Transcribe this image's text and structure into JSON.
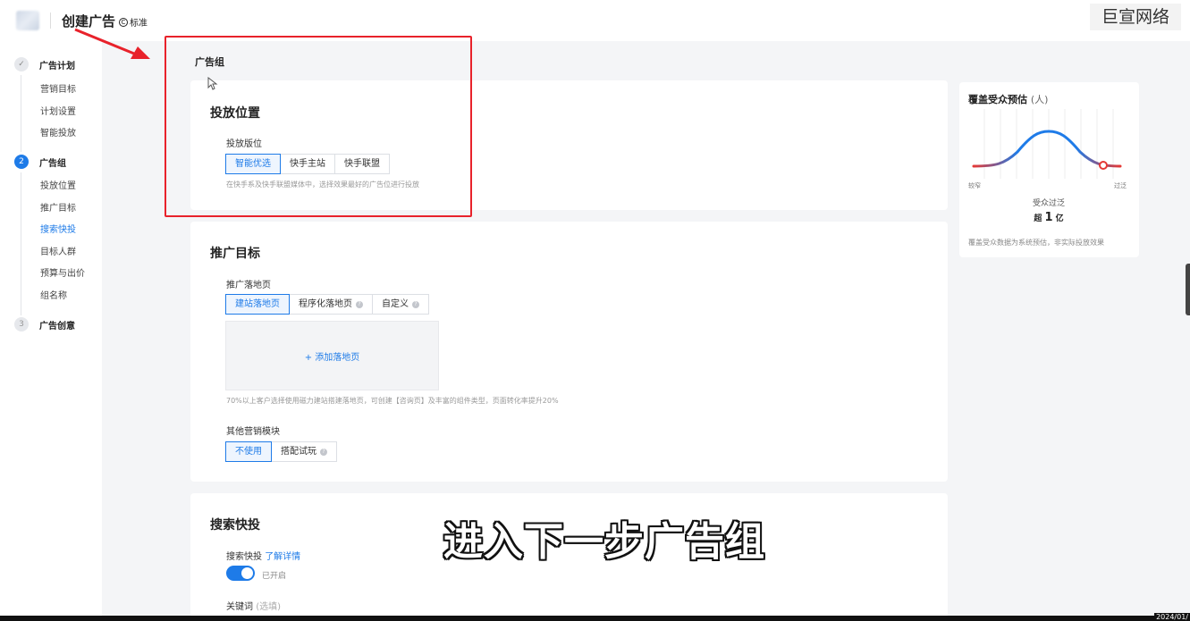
{
  "header": {
    "title": "创建广告",
    "badge": "标准",
    "watermark": "巨宣网络"
  },
  "sidebar": {
    "steps": [
      {
        "number": "✓",
        "title": "广告计划",
        "items": [
          "营销目标",
          "计划设置",
          "智能投放"
        ]
      },
      {
        "number": "2",
        "title": "广告组",
        "items": [
          "投放位置",
          "推广目标",
          "搜索快投",
          "目标人群",
          "预算与出价",
          "组名称"
        ],
        "current_item": "搜索快投"
      },
      {
        "number": "3",
        "title": "广告创意",
        "items": []
      }
    ]
  },
  "main": {
    "group_title": "广告组",
    "placement": {
      "title": "投放位置",
      "field_label": "投放版位",
      "options": [
        "智能优选",
        "快手主站",
        "快手联盟"
      ],
      "selected": "智能优选",
      "hint": "在快手系及快手联盟媒体中，选择效果最好的广告位进行投放"
    },
    "target": {
      "title": "推广目标",
      "landing_label": "推广落地页",
      "landing_options": [
        "建站落地页",
        "程序化落地页",
        "自定义"
      ],
      "selected": "建站落地页",
      "add_button": "+ 添加落地页",
      "hint": "70%以上客户选择使用磁力建站搭建落地页，可创建【咨询页】及丰富的组件类型，页面转化率提升20%",
      "other_label": "其他营销模块",
      "other_options": [
        "不使用",
        "搭配试玩"
      ],
      "other_selected": "不使用"
    },
    "search": {
      "title": "搜索快投",
      "field_label": "搜索快投",
      "link": "了解详情",
      "toggle_state": "已开启",
      "keyword_label": "关键词",
      "keyword_optional": "(选填)"
    }
  },
  "estimate": {
    "title": "覆盖受众预估",
    "unit": "(人)",
    "axis_left": "较窄",
    "axis_right": "过泛",
    "level": "受众过泛",
    "size_prefix": "超",
    "size_value": "1",
    "size_unit": "亿",
    "note": "覆盖受众数据为系统预估，非实际投放效果"
  },
  "overlay": {
    "subtitle": "进入下一步广告组",
    "date": "2024/01/"
  }
}
